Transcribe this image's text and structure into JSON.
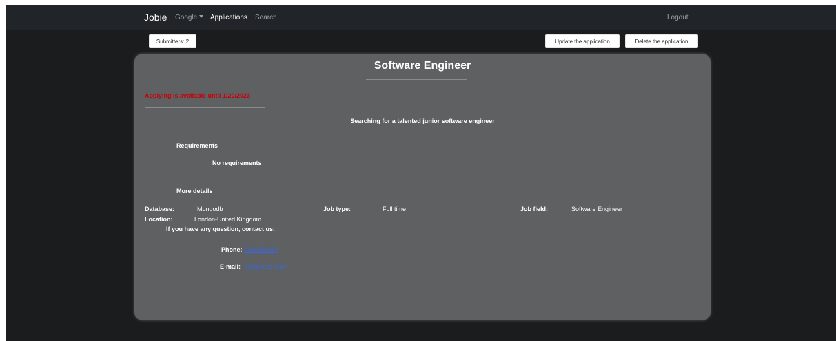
{
  "navbar": {
    "brand": "Jobie",
    "company_dropdown": "Google",
    "applications_link": "Applications",
    "search_link": "Search",
    "logout_link": "Logout"
  },
  "toolbar": {
    "submitters_label": "Submitters: 2",
    "update_label": "Update the application",
    "delete_label": "Delete the application"
  },
  "job": {
    "title": "Software Engineer",
    "deadline": "Applying is available until 1/20/2023",
    "summary": "Searching for a talented junior software engineer",
    "requirements_heading": "Requirements",
    "requirements_text": "No requirements",
    "details_heading": "More details",
    "details": {
      "database_label": "Database:",
      "database_value": "Mongodb",
      "job_type_label": "Job type:",
      "job_type_value": "Full time",
      "job_field_label": "Job field:",
      "job_field_value": "Software Engineer",
      "location_label": "Location:",
      "location_value": "London-United Kingdom"
    },
    "contact": {
      "heading": "If you have any question, contact us:",
      "phone_label": "Phone:",
      "phone_value": "0546458456",
      "email_label": "E-mail:",
      "email_value": "hr@google.com"
    }
  },
  "colors": {
    "page_bg": "#1b1c1e",
    "navbar_bg": "#212529",
    "card_bg": "#5f6061",
    "deadline": "#c8000a",
    "link": "#3b66d6"
  }
}
